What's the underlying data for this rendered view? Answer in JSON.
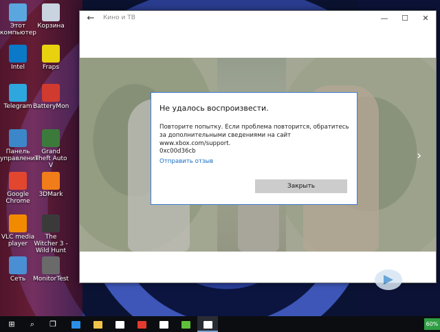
{
  "desktop": {
    "icons": [
      {
        "label": "Этот компьютер",
        "icon": "computer-icon",
        "color": "#5aa7e0"
      },
      {
        "label": "Корзина",
        "icon": "recycle-bin-icon",
        "color": "#c9d4e0"
      },
      {
        "label": "Intel",
        "icon": "intel-icon",
        "color": "#0a79c8"
      },
      {
        "label": "Fraps",
        "icon": "fraps-icon",
        "color": "#e8d20f"
      },
      {
        "label": "Telegram",
        "icon": "telegram-icon",
        "color": "#2ea6de"
      },
      {
        "label": "BatteryMon",
        "icon": "batterymon-icon",
        "color": "#d13b2f"
      },
      {
        "label": "Панель управления",
        "icon": "control-panel-icon",
        "color": "#3b87c9"
      },
      {
        "label": "Grand Theft Auto V",
        "icon": "gta-icon",
        "color": "#3c7a3c"
      },
      {
        "label": "Google Chrome",
        "icon": "chrome-icon",
        "color": "#e2462f"
      },
      {
        "label": "3DMark",
        "icon": "3dmark-icon",
        "color": "#f07d1a"
      },
      {
        "label": "VLC media player",
        "icon": "vlc-icon",
        "color": "#f28a00"
      },
      {
        "label": "The Witcher 3 - Wild Hunt",
        "icon": "witcher-icon",
        "color": "#3a3a3a"
      },
      {
        "label": "Сеть",
        "icon": "network-icon",
        "color": "#4a8fd4"
      },
      {
        "label": "MonitorTest",
        "icon": "monitortest-icon",
        "color": "#6a6a6a"
      }
    ]
  },
  "window": {
    "title": "Кино и ТВ",
    "back_glyph": "←",
    "minimize_glyph": "—",
    "maximize_glyph": "☐",
    "close_glyph": "✕",
    "next_glyph": "›"
  },
  "dialog": {
    "title": "Не удалось воспроизвести.",
    "message": "Повторите попытку. Если проблема повторится, обратитесь за дополнительными сведениями на сайт www.xbox.com/support.",
    "error_code": "0xc00d36cb",
    "feedback_link": "Отправить отзыв",
    "close_button": "Закрыть"
  },
  "taskbar": {
    "start_glyph": "⊞",
    "search_glyph": "⌕",
    "task_view_glyph": "❐",
    "apps": [
      {
        "icon": "edge-icon",
        "color": "#2b8ee6"
      },
      {
        "icon": "file-explorer-icon",
        "color": "#f2c34a"
      },
      {
        "icon": "store-icon",
        "color": "#ffffff"
      },
      {
        "icon": "pen-app-icon",
        "color": "#e23b2e"
      },
      {
        "icon": "mail-icon",
        "color": "#ffffff"
      },
      {
        "icon": "utorrent-icon",
        "color": "#5fbf3a"
      },
      {
        "icon": "movies-tv-icon",
        "color": "#ffffff"
      }
    ],
    "battery": "60%"
  }
}
